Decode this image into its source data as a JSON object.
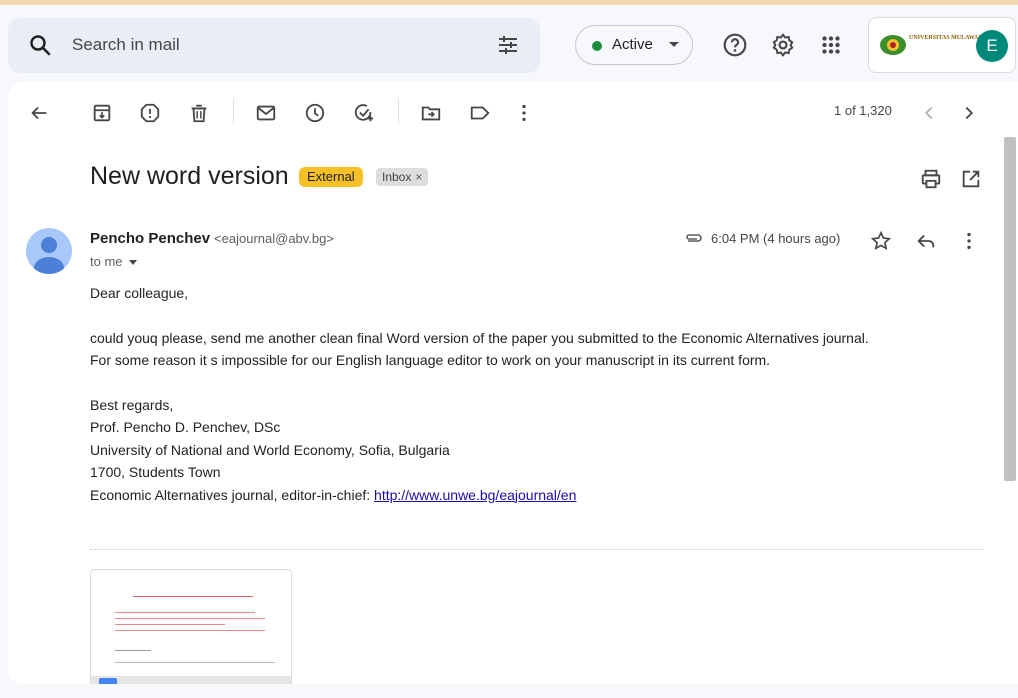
{
  "search": {
    "placeholder": "Search in mail"
  },
  "status": {
    "label": "Active",
    "color": "#1e8e3e"
  },
  "header_icons": [
    "help-icon",
    "settings-icon",
    "apps-icon"
  ],
  "account": {
    "org_logo_text": "UNIVERSITAS MULAWARMAN",
    "avatar_letter": "E",
    "avatar_color": "#00897b"
  },
  "toolbar": {
    "icons": [
      "back-arrow-icon",
      "archive-icon",
      "report-spam-icon",
      "delete-icon",
      "mark-unread-icon",
      "snooze-icon",
      "add-task-icon",
      "move-to-icon",
      "label-icon",
      "more-icon"
    ],
    "count": "1 of 1,320"
  },
  "message": {
    "subject": "New word version",
    "badges": {
      "external": "External",
      "inbox": "Inbox",
      "inbox_close": "×"
    },
    "sender_name": "Pencho Penchev",
    "sender_email": "<eajournal@abv.bg>",
    "recipient": "to me",
    "time": "6:04 PM (4 hours ago)",
    "body": {
      "greeting": "Dear colleague,",
      "line1": "could youq please, send me another clean final Word version of the paper you submitted to the Economic Alternatives journal.",
      "line2": "For some reason it s impossible for our English language editor to work on your manuscript in its current form.",
      "sign1": "Best regards,",
      "sign2": "Prof. Pencho D. Penchev, DSc",
      "sign3": "University of National and World Economy, Sofia, Bulgaria",
      "sign4": "1700, Students Town",
      "sign5_prefix": "Economic Alternatives journal, editor-in-chief: ",
      "link": "http://www.unwe.bg/eajournal/en"
    }
  }
}
